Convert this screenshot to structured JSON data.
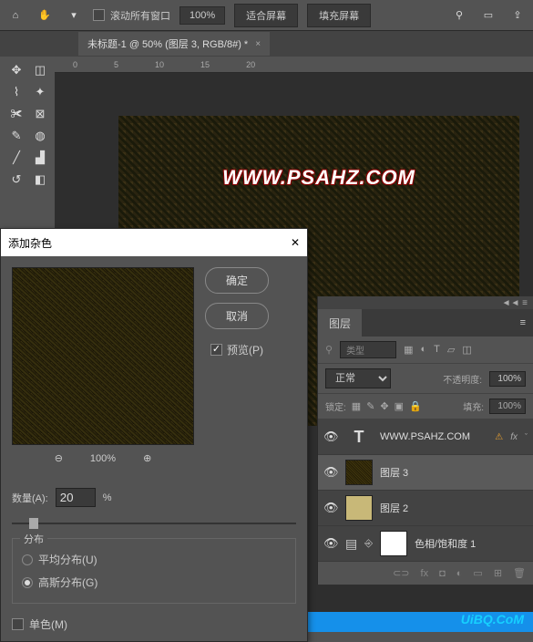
{
  "toolbar": {
    "scroll_all_label": "滚动所有窗口",
    "zoom_value": "100%",
    "fit_screen": "适合屏幕",
    "fill_screen": "填充屏幕"
  },
  "document": {
    "tab_title": "未标题-1 @ 50% (图层 3, RGB/8#) *",
    "canvas_text": "WWW.PSAHZ.COM"
  },
  "ruler": {
    "m1": "0",
    "m2": "5",
    "m3": "10",
    "m4": "15",
    "m5": "20"
  },
  "dialog": {
    "title": "添加杂色",
    "ok": "确定",
    "cancel": "取消",
    "preview_label": "预览(P)",
    "preview_zoom": "100%",
    "amount_label": "数量(A):",
    "amount_value": "20",
    "amount_unit": "%",
    "dist_group": "分布",
    "dist_uniform": "平均分布(U)",
    "dist_gaussian": "高斯分布(G)",
    "mono_label": "单色(M)"
  },
  "layers": {
    "panel_title": "图层",
    "filter_kind": "类型",
    "blend_mode": "正常",
    "opacity_label": "不透明度:",
    "opacity_value": "100%",
    "lock_label": "锁定:",
    "fill_label": "填充:",
    "fill_value": "100%",
    "items": [
      {
        "name": "WWW.PSAHZ.COM",
        "fx": "fx"
      },
      {
        "name": "图层 3"
      },
      {
        "name": "图层 2"
      },
      {
        "name": "色相/饱和度 1"
      }
    ]
  },
  "watermark": "UiBQ.CoM"
}
